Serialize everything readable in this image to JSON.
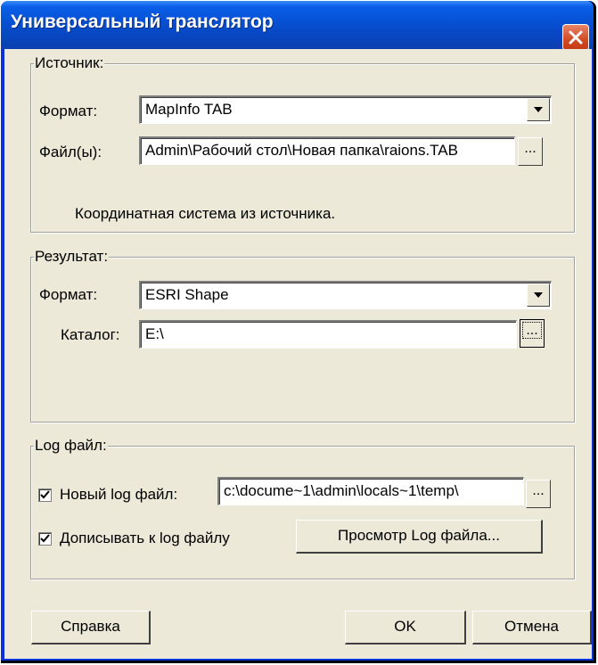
{
  "window": {
    "title": "Универсальный транслятор"
  },
  "source": {
    "legend": "Источник:",
    "format_label": "Формат:",
    "format_value": "MapInfo TAB",
    "files_label": "Файл(ы):",
    "files_value": "Admin\\Рабочий стол\\Новая папка\\raions.TAB",
    "browse_label": "...",
    "coord_text": "Координатная система из источника."
  },
  "result": {
    "legend": "Результат:",
    "format_label": "Формат:",
    "format_value": "ESRI Shape",
    "catalog_label": "Каталог:",
    "catalog_value": "E:\\",
    "browse_label": "..."
  },
  "log": {
    "legend": "Log файл:",
    "new_log_label": "Новый log файл:",
    "new_log_checked": true,
    "new_log_value": "c:\\docume~1\\admin\\locals~1\\temp\\",
    "browse_label": "...",
    "append_label": "Дописывать к log файлу",
    "append_checked": true,
    "view_button": "Просмотр Log файла..."
  },
  "buttons": {
    "help": "Справка",
    "ok": "OK",
    "cancel": "Отмена"
  }
}
